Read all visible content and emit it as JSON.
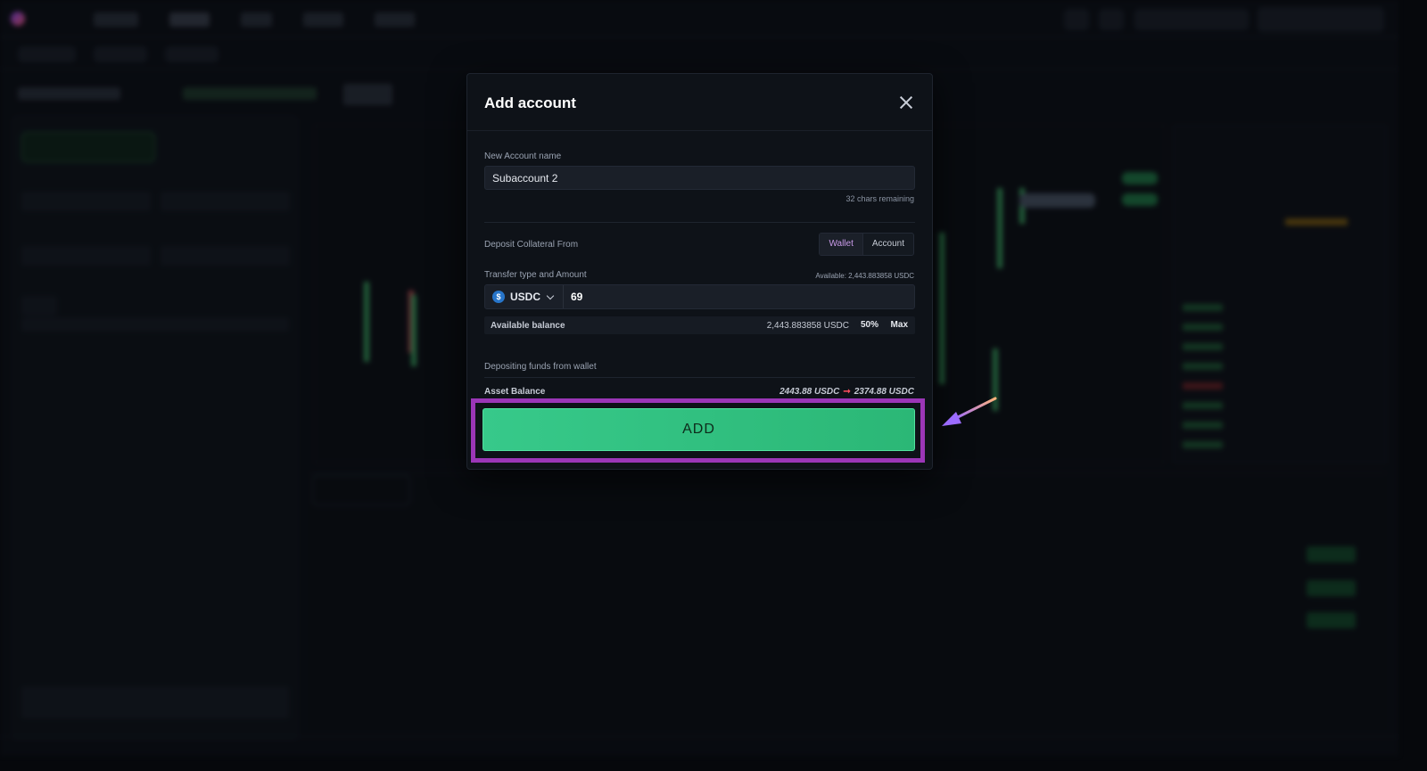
{
  "modal": {
    "title": "Add account",
    "account_name_label": "New Account name",
    "account_name_value": "Subaccount 2",
    "chars_remaining": "32 chars remaining",
    "deposit_from_label": "Deposit Collateral From",
    "deposit_sources": [
      "Wallet",
      "Account"
    ],
    "deposit_source_selected": "Wallet",
    "transfer_label": "Transfer type and Amount",
    "available_top": "Available: 2,443.883858 USDC",
    "token": "USDC",
    "amount_value": "69",
    "available_balance_label": "Available balance",
    "available_balance_value": "2,443.883858 USDC",
    "pct_50": "50%",
    "pct_max": "Max",
    "depositing_label": "Depositing funds from wallet",
    "asset_balance_label": "Asset Balance",
    "asset_balance_from": "2443.88 USDC",
    "asset_balance_to": "2374.88 USDC",
    "add_label": "ADD"
  },
  "colors": {
    "accent_green": "#37c98a",
    "highlight_purple": "#9b36b7",
    "wallet_active": "#c99be9",
    "arrow_red": "#ff4d5e"
  },
  "icons": {
    "close": "close-icon",
    "token": "usdc-icon",
    "dropdown": "chevron-down-icon",
    "pointer": "arrow-pointer-icon"
  }
}
